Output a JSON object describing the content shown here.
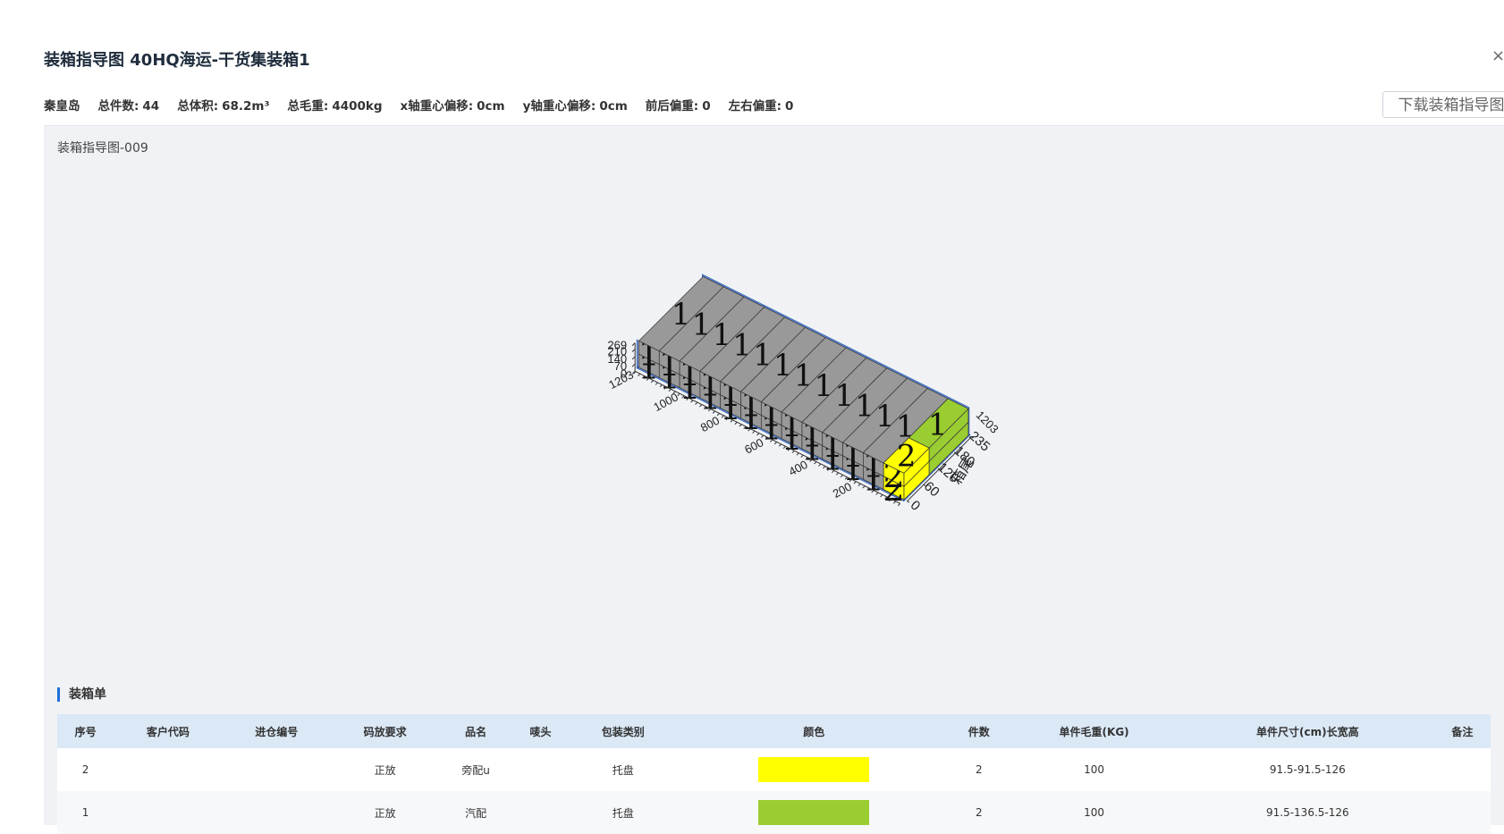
{
  "dialog": {
    "title": "装箱指导图 40HQ海运-干货集装箱1",
    "close_glyph": "×",
    "download_label": "下载装箱指导图"
  },
  "summary": [
    {
      "label": "秦皇岛",
      "value": ""
    },
    {
      "label": "总件数:",
      "value": "44"
    },
    {
      "label": "总体积:",
      "value": "68.2m³"
    },
    {
      "label": "总毛重:",
      "value": "4400kg"
    },
    {
      "label": "x轴重心偏移:",
      "value": "0cm"
    },
    {
      "label": "y轴重心偏移:",
      "value": "0cm"
    },
    {
      "label": "前后偏重:",
      "value": "0"
    },
    {
      "label": "左右偏重:",
      "value": "0"
    }
  ],
  "diagram": {
    "label": "装箱指导图-009",
    "height_ticks": [
      "269",
      "210",
      "140",
      "70",
      "0"
    ],
    "length_ticks": [
      "200",
      "400",
      "600",
      "800",
      "1000",
      "1203"
    ],
    "width_ticks": [
      "0",
      "60",
      "120",
      "180",
      "235"
    ],
    "far_length_label": "1203",
    "width_axis_title": "箱尾",
    "cargo_label_main": "1",
    "cargo_label_yellow": "2",
    "colors": {
      "gray": "#999999",
      "yellow": "#ffff00",
      "green": "#9acd32",
      "container": "#5b88d6"
    }
  },
  "packing_list": {
    "title": "装箱单",
    "headers": [
      "序号",
      "客户代码",
      "进仓编号",
      "码放要求",
      "品名",
      "唛头",
      "包装类别",
      "颜色",
      "件数",
      "单件毛重(KG)",
      "单件尺寸(cm)长宽高",
      "备注"
    ],
    "rows": [
      {
        "seq": "2",
        "customer": "",
        "warehouse": "",
        "stacking": "正放",
        "name": "旁配u",
        "mark": "",
        "package": "托盘",
        "color": "#ffff00",
        "qty": "2",
        "weight": "100",
        "size": "91.5-91.5-126",
        "note": ""
      },
      {
        "seq": "1",
        "customer": "",
        "warehouse": "",
        "stacking": "正放",
        "name": "汽配",
        "mark": "",
        "package": "托盘",
        "color": "#9acd32",
        "qty": "2",
        "weight": "100",
        "size": "91.5-136.5-126",
        "note": ""
      }
    ]
  }
}
